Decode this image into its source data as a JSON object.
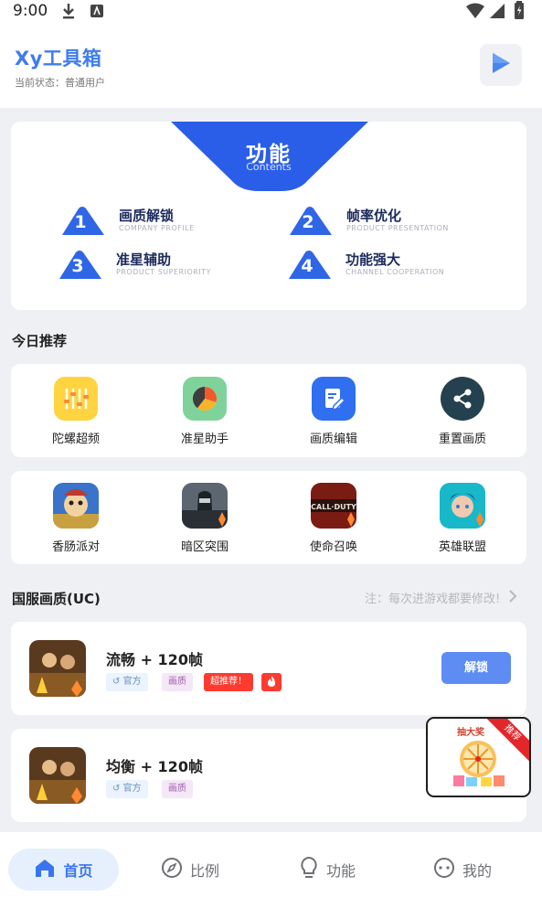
{
  "status_bar": {
    "time": "9:00"
  },
  "header": {
    "title": "Xy工具箱",
    "status": "当前状态：普通用户"
  },
  "banner": {
    "title": "功能",
    "subtitle": "Contents",
    "features": [
      {
        "num": "1",
        "title": "画质解锁",
        "subtitle": "COMPANY PROFILE"
      },
      {
        "num": "2",
        "title": "帧率优化",
        "subtitle": "PRODUCT PRESENTATION"
      },
      {
        "num": "3",
        "title": "准星辅助",
        "subtitle": "PRODUCT SUPERIORITY"
      },
      {
        "num": "4",
        "title": "功能强大",
        "subtitle": "CHANNEL COOPERATION"
      }
    ]
  },
  "recommend": {
    "title": "今日推荐",
    "tools": [
      {
        "label": "陀螺超频",
        "icon": "sliders-icon"
      },
      {
        "label": "准星助手",
        "icon": "pie-chart-icon"
      },
      {
        "label": "画质编辑",
        "icon": "edit-document-icon"
      },
      {
        "label": "重置画质",
        "icon": "share-icon"
      }
    ],
    "games": [
      {
        "label": "香肠派对",
        "icon": "sausage-party-icon"
      },
      {
        "label": "暗区突围",
        "icon": "arena-breakout-icon"
      },
      {
        "label": "使命召唤",
        "icon": "call-of-duty-icon"
      },
      {
        "label": "英雄联盟",
        "icon": "league-of-legends-icon"
      }
    ]
  },
  "uc_section": {
    "title": "国服画质(UC)",
    "note": "注：每次进游戏都要修改!",
    "items": [
      {
        "title": "流畅 + 120帧",
        "tags": [
          "官方",
          "画质",
          "超推荐！"
        ],
        "hot": true,
        "button": "解锁"
      },
      {
        "title": "均衡 + 120帧",
        "tags": [
          "官方",
          "画质"
        ],
        "hot": false,
        "button": ""
      }
    ]
  },
  "float_ad": {
    "title": "抽大奖",
    "ribbon": "推荐"
  },
  "bottom_nav": [
    {
      "label": "首页",
      "icon": "home-icon",
      "active": true
    },
    {
      "label": "比例",
      "icon": "compass-icon",
      "active": false
    },
    {
      "label": "功能",
      "icon": "lightbulb-icon",
      "active": false
    },
    {
      "label": "我的",
      "icon": "profile-icon",
      "active": false
    }
  ],
  "colors": {
    "primary": "#3f7cef",
    "button": "#5d8cf3",
    "hot_tag": "#ff3b30",
    "background": "#eef0f3"
  }
}
